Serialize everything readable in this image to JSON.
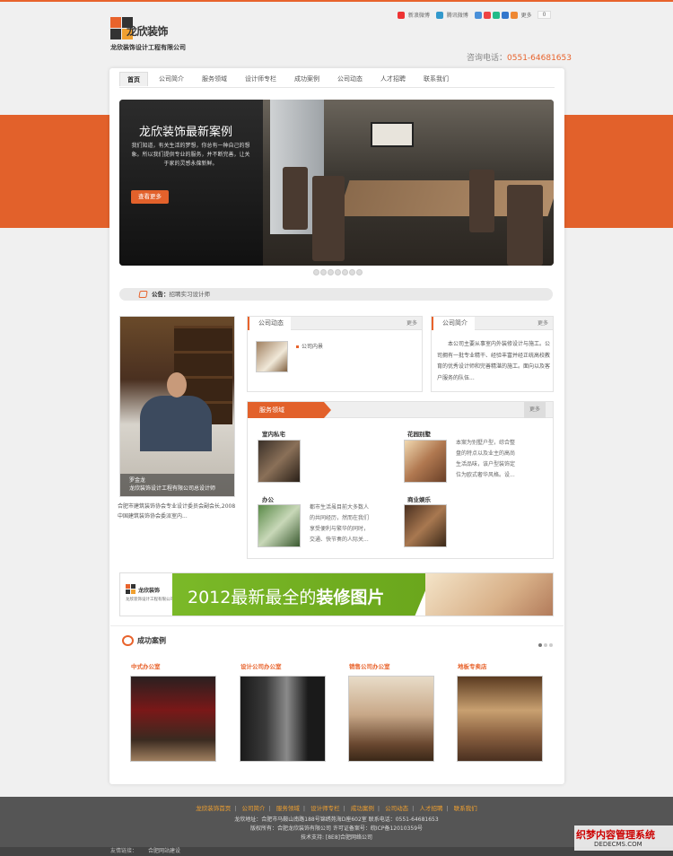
{
  "header": {
    "logo_title": "龙欣装饰",
    "logo_subtitle": "龙欣装饰设计工程有限公司",
    "share_sina": "新浪微博",
    "share_tencent": "腾讯微博",
    "share_more": "更多",
    "share_count": "0",
    "phone_label": "咨询电话：",
    "phone_number": "0551-64681653"
  },
  "nav": {
    "items": [
      "首页",
      "公司简介",
      "服务领域",
      "设计师专栏",
      "成功案例",
      "公司动态",
      "人才招聘",
      "联系我们"
    ]
  },
  "banner": {
    "title": "龙欣装饰最新案例",
    "description": "我们知道，有关生活的梦想，你总有一种自己的想象。所以我们提供专业的服务，并不断完善，让关于家的灵感永葆新鲜。",
    "button": "查看更多"
  },
  "notice": {
    "label": "公告：",
    "text": "招聘实习设计师"
  },
  "designer": {
    "name": "罗金龙",
    "title": "龙欣装饰设计工程有限公司总设计师",
    "bio": "合肥市建筑装饰协会专业设计委员会副会长,2008中国建筑装饰协会委派室内..."
  },
  "news": {
    "title": "公司动态",
    "more": "更多",
    "items": [
      "公司内景"
    ]
  },
  "about": {
    "title": "公司简介",
    "more": "更多",
    "text": "本公司主要从事室内外装修设计与施工。公司拥有一批专业精干、经验丰富并经正统高校教育的优秀设计师和完善精湛的施工。面向以及客户服务的队伍..."
  },
  "services": {
    "title": "服务领域",
    "more": "更多",
    "items": [
      {
        "title": "室内私宅",
        "desc": ""
      },
      {
        "title": "花园别墅",
        "desc": "本案为别墅户型，综合整盘的特点以及业主的高尚生活品味，该户型装饰定位为欧式奢华风格。设..."
      },
      {
        "title": "办公",
        "desc": "都市生活虽目前大多数人的共同经历，然而在我们享受便利与繁华的同时，交通、快节奏的人际关..."
      },
      {
        "title": "商业娱乐",
        "desc": ""
      }
    ]
  },
  "ad": {
    "logo_text": "龙欣装饰",
    "logo_sub": "龙欣装饰设计工程有限公司",
    "text_normal": "2012最新最全的",
    "text_bold": "装修图片"
  },
  "cases": {
    "title": "成功案例",
    "items": [
      "中式办公室",
      "设计公司办公室",
      "销售公司办公室",
      "地板专卖店"
    ]
  },
  "footer": {
    "links": [
      "龙欣装饰首页",
      "公司简介",
      "服务领域",
      "设计师专栏",
      "成功案例",
      "公司动态",
      "人才招聘",
      "联系我们"
    ],
    "address": "龙欣地址：合肥市马鞍山南路188号锦绣苑海D座602室 联系电话：0551-64681653",
    "copyright": "版权所有：合肥龙欣装饰有限公司 许可证备案号：皖ICP备12010359号",
    "support": "技术支持: [8E8]合肥网络公司",
    "friend_label": "友情链接：",
    "friend_link": "合肥网站建设"
  },
  "watermark": {
    "line1": "织梦内容管理系统",
    "line2": "DEDECMS.COM"
  },
  "colors": {
    "accent": "#e2612b",
    "green": "#7bb928",
    "footer": "#555555"
  }
}
